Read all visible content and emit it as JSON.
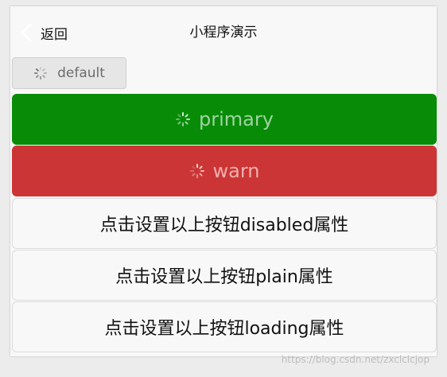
{
  "navbar": {
    "back_label": "返回",
    "title": "小程序演示"
  },
  "buttons": {
    "default_label": "default",
    "primary_label": "primary",
    "warn_label": "warn",
    "disabled_toggle_label": "点击设置以上按钮disabled属性",
    "plain_toggle_label": "点击设置以上按钮plain属性",
    "loading_toggle_label": "点击设置以上按钮loading属性"
  },
  "icons": {
    "back": "chevron-left-icon",
    "loading": "loading-spinner-icon"
  },
  "colors": {
    "primary_bg": "#088c08",
    "warn_bg": "#cc3535",
    "default_bg": "#e6e6e6",
    "page_bg": "#f8f8f8"
  },
  "watermark": "https://blog.csdn.net/zxclclcjop"
}
